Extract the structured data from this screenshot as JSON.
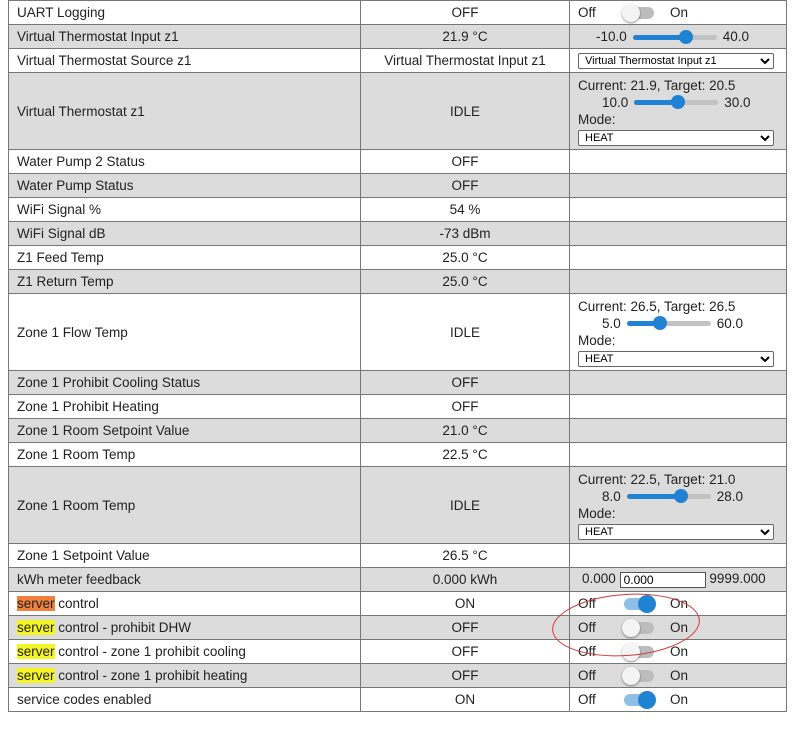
{
  "rows": [
    {
      "name": "UART Logging",
      "state": "OFF",
      "control": "switch",
      "off": "Off",
      "on": "On",
      "checked": false
    },
    {
      "name": "Virtual Thermostat Input z1",
      "state": "21.9 °C",
      "control": "slider",
      "min": "-10.0",
      "max": "40.0",
      "value": 21.9,
      "lo": -10,
      "hi": 40
    },
    {
      "name": "Virtual Thermostat Source z1",
      "state": "Virtual Thermostat Input z1",
      "control": "select",
      "selected": "Virtual Thermostat Input z1"
    },
    {
      "name": "Virtual Thermostat z1",
      "state": "IDLE",
      "control": "climate",
      "current_target": "Current: 21.9, Target: 20.5",
      "min": "10.0",
      "max": "30.0",
      "value": 20.5,
      "lo": 10,
      "hi": 30,
      "mode_label": "Mode:",
      "mode": "HEAT"
    },
    {
      "name": "Water Pump 2 Status",
      "state": "OFF",
      "control": "none"
    },
    {
      "name": "Water Pump Status",
      "state": "OFF",
      "control": "none"
    },
    {
      "name": "WiFi Signal %",
      "state": "54 %",
      "control": "none"
    },
    {
      "name": "WiFi Signal dB",
      "state": "-73 dBm",
      "control": "none"
    },
    {
      "name": "Z1 Feed Temp",
      "state": "25.0 °C",
      "control": "none"
    },
    {
      "name": "Z1 Return Temp",
      "state": "25.0 °C",
      "control": "none"
    },
    {
      "name": "Zone 1 Flow Temp",
      "state": "IDLE",
      "control": "climate",
      "current_target": "Current: 26.5, Target: 26.5",
      "min": "5.0",
      "max": "60.0",
      "value": 26.5,
      "lo": 5,
      "hi": 60,
      "mode_label": "Mode:",
      "mode": "HEAT"
    },
    {
      "name": "Zone 1 Prohibit Cooling Status",
      "state": "OFF",
      "control": "none"
    },
    {
      "name": "Zone 1 Prohibit Heating",
      "state": "OFF",
      "control": "none"
    },
    {
      "name": "Zone 1 Room Setpoint Value",
      "state": "21.0 °C",
      "control": "none"
    },
    {
      "name": "Zone 1 Room Temp",
      "state": "22.5 °C",
      "control": "none"
    },
    {
      "name": "Zone 1 Room Temp",
      "state": "IDLE",
      "control": "climate",
      "current_target": "Current: 22.5, Target: 21.0",
      "min": "8.0",
      "max": "28.0",
      "value": 21.0,
      "lo": 8,
      "hi": 28,
      "mode_label": "Mode:",
      "mode": "HEAT"
    },
    {
      "name": "Zone 1 Setpoint Value",
      "state": "26.5 °C",
      "control": "none"
    },
    {
      "name": "kWh meter feedback",
      "state": "0.000 kWh",
      "control": "number",
      "min": "0.000",
      "value": "0.000",
      "max": "9999.000"
    },
    {
      "name_hl": "server",
      "name_rest": " control",
      "hl_color": "orange",
      "state": "ON",
      "control": "switch",
      "off": "Off",
      "on": "On",
      "checked": true
    },
    {
      "name_hl": "server",
      "name_rest": " control - prohibit DHW",
      "hl_color": "yellow",
      "state": "OFF",
      "control": "switch",
      "off": "Off",
      "on": "On",
      "checked": false
    },
    {
      "name_hl": "server",
      "name_rest": " control - zone 1 prohibit cooling",
      "hl_color": "yellow",
      "state": "OFF",
      "control": "switch",
      "off": "Off",
      "on": "On",
      "checked": false
    },
    {
      "name_hl": "server",
      "name_rest": " control - zone 1 prohibit heating",
      "hl_color": "yellow",
      "state": "OFF",
      "control": "switch",
      "off": "Off",
      "on": "On",
      "checked": false
    },
    {
      "name": "service codes enabled",
      "state": "ON",
      "control": "switch",
      "off": "Off",
      "on": "On",
      "checked": true
    }
  ],
  "row_shading": [
    "white",
    "gray",
    "white",
    "gray",
    "white",
    "gray",
    "white",
    "gray",
    "white",
    "gray",
    "white",
    "gray",
    "white",
    "gray",
    "white",
    "gray",
    "white",
    "gray",
    "white",
    "gray",
    "white",
    "gray",
    "white"
  ],
  "colors": {
    "accent": "#1f82d2",
    "annotation": "#d23a3a",
    "highlight_yellow": "#f4f427",
    "highlight_orange": "#f0803a",
    "row_gray": "#dcdcdc"
  }
}
